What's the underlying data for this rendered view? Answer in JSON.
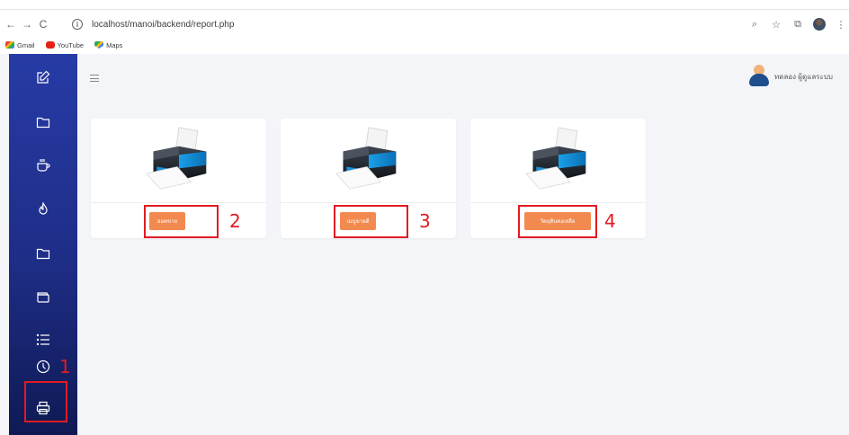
{
  "browser": {
    "back_icon": "←",
    "forward_icon": "→",
    "reload_icon": "C",
    "info_icon": "i",
    "url": "localhost/manoi/backend/report.php",
    "zoom_icon": "⌕",
    "star_icon": "☆",
    "extensions_icon": "⧉",
    "menu_icon": "⋮"
  },
  "bookmarks": [
    {
      "label": "Gmail"
    },
    {
      "label": "YouTube"
    },
    {
      "label": "Maps"
    }
  ],
  "sidebar": {
    "items": [
      {
        "name": "edit",
        "icon": "edit-icon"
      },
      {
        "name": "folder",
        "icon": "folder-icon"
      },
      {
        "name": "coffee",
        "icon": "coffee-icon"
      },
      {
        "name": "flame",
        "icon": "flame-icon"
      },
      {
        "name": "folder-2",
        "icon": "folder-icon"
      },
      {
        "name": "wallet",
        "icon": "wallet-icon"
      },
      {
        "name": "list",
        "icon": "list-icon"
      },
      {
        "name": "history",
        "icon": "clock-icon"
      },
      {
        "name": "print",
        "icon": "printer-icon",
        "selected": true
      }
    ]
  },
  "header": {
    "user_name": "ทดลอง ผู้ดูแลระบบ"
  },
  "cards": [
    {
      "button_label": "ยอดขาย"
    },
    {
      "button_label": "เมนูขายดี"
    },
    {
      "button_label": "วัตถุดิบคงเหลือ"
    }
  ],
  "callouts": [
    "1",
    "2",
    "3",
    "4"
  ],
  "colors": {
    "sidebar_top": "#273ba6",
    "sidebar_bottom": "#0f1a54",
    "button": "#f28a4f",
    "callout": "#e11b22",
    "page_bg": "#f4f5f9"
  }
}
